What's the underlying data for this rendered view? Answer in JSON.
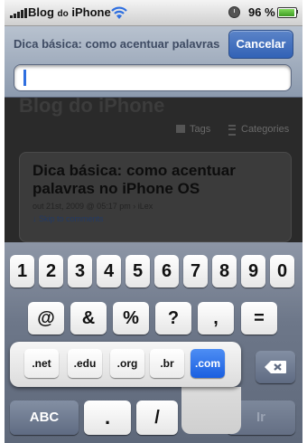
{
  "status_bar": {
    "carrier_main": "Blog",
    "carrier_small": "do",
    "carrier_end": "iPhone",
    "battery_text": "96 %",
    "battery_level": 0.96
  },
  "url_bar": {
    "page_title": "Dica básica: como acentuar palavras no iPhone OS",
    "cancel_label": "Cancelar",
    "url_value": ""
  },
  "page": {
    "site_name": "Blog do iPhone",
    "nav_tags": "Tags",
    "nav_categories": "Categories",
    "post_title": "Dica básica: como acentuar palavras no iPhone OS",
    "post_meta": "out 21st, 2009 @ 05:17 pm › iLex",
    "skip_link": "↓ Skip to comments"
  },
  "keyboard": {
    "numbers": [
      "1",
      "2",
      "3",
      "4",
      "5",
      "6",
      "7",
      "8",
      "9",
      "0"
    ],
    "symbols": [
      "@",
      "&",
      "%",
      "?",
      ",",
      "="
    ],
    "domains": [
      ".net",
      ".edu",
      ".org",
      ".br",
      ".com"
    ],
    "selected_domain": ".com",
    "abc_label": "ABC",
    "dot_label": ".",
    "slash_label": "/",
    "go_label": "Ir"
  }
}
